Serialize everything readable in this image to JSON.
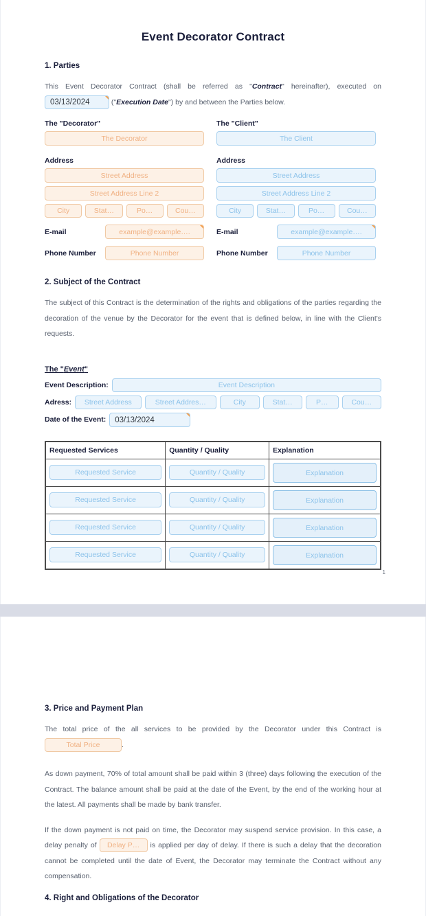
{
  "document": {
    "title": "Event Decorator Contract",
    "page_number": "1"
  },
  "section1": {
    "heading": "1. Parties",
    "intro_a": "This Event Decorator Contract (shall be referred as \"",
    "intro_contract_term": "Contract",
    "intro_b": "\" hereinafter), executed on",
    "execution_date_value": "03/13/2024",
    "intro_c": "(\"",
    "intro_exec_term": "Execution Date",
    "intro_d": "\") by and between the Parties below.",
    "decorator": {
      "title": "The \"Decorator\"",
      "name_placeholder": "The Decorator",
      "address_label": "Address",
      "street1_placeholder": "Street Address",
      "street2_placeholder": "Street Address Line 2",
      "city_placeholder": "City",
      "state_placeholder": "Stat…",
      "postal_placeholder": "Po…",
      "country_placeholder": "Cou…",
      "email_label": "E-mail",
      "email_placeholder": "example@example….",
      "phone_label": "Phone Number",
      "phone_placeholder": "Phone Number"
    },
    "client": {
      "title": "The \"Client\"",
      "name_placeholder": "The Client",
      "address_label": "Address",
      "street1_placeholder": "Street Address",
      "street2_placeholder": "Street Address Line 2",
      "city_placeholder": "City",
      "state_placeholder": "Stat…",
      "postal_placeholder": "Po…",
      "country_placeholder": "Cou…",
      "email_label": "E-mail",
      "email_placeholder": "example@example….",
      "phone_label": "Phone Number",
      "phone_placeholder": "Phone Number"
    }
  },
  "section2": {
    "heading": "2. Subject of the Contract",
    "paragraph": "The subject of this Contract is the determination of the rights and obligations of the parties regarding the decoration of the venue by the Decorator for the event that is defined below, in line with the Client's requests.",
    "event_head_prefix": "The \"",
    "event_head_term": "Event",
    "event_head_suffix": "\"",
    "event_description_label": "Event Description:",
    "event_description_placeholder": "Event Description",
    "address_label": "Adress:",
    "address_street1_placeholder": "Street Address",
    "address_street2_placeholder": "Street Addres…",
    "address_city_placeholder": "City",
    "address_state_placeholder": "Stat…",
    "address_postal_placeholder": "P…",
    "address_country_placeholder": "Cou…",
    "date_label": "Date of the Event:",
    "date_value": "03/13/2024"
  },
  "services_table": {
    "columns": [
      "Requested Services",
      "Quantity / Quality",
      "Explanation"
    ],
    "rows": [
      {
        "service": "Requested Service",
        "quantity": "Quantity / Quality",
        "explanation": "Explanation"
      },
      {
        "service": "Requested Service",
        "quantity": "Quantity / Quality",
        "explanation": "Explanation"
      },
      {
        "service": "Requested Service",
        "quantity": "Quantity / Quality",
        "explanation": "Explanation"
      },
      {
        "service": "Requested Service",
        "quantity": "Quantity / Quality",
        "explanation": "Explanation"
      }
    ]
  },
  "section3": {
    "heading": "3. Price and Payment Plan",
    "price_text_a": "The total price of the all services to be provided by the Decorator under this Contract is",
    "total_price_placeholder": "Total Price",
    "price_text_b": ".",
    "paragraph_down_payment": "As down payment, 70% of total amount shall be paid within 3 (three) days following the execution of the Contract. The balance amount shall be paid at the date of the Event, by the end of the working hour at the latest. All payments shall be made by bank transfer.",
    "delay_text_a": "If the down payment is not paid on time, the Decorator may suspend service provision. In this case, a delay penalty of",
    "delay_penalty_placeholder": "Delay P…",
    "delay_text_b": "is applied per day of delay. If there is such a delay that the decoration cannot be completed until the date of Event, the Decorator may terminate the Contract without any compensation."
  },
  "section4": {
    "heading": "4. Right and Obligations of the Decorator"
  }
}
